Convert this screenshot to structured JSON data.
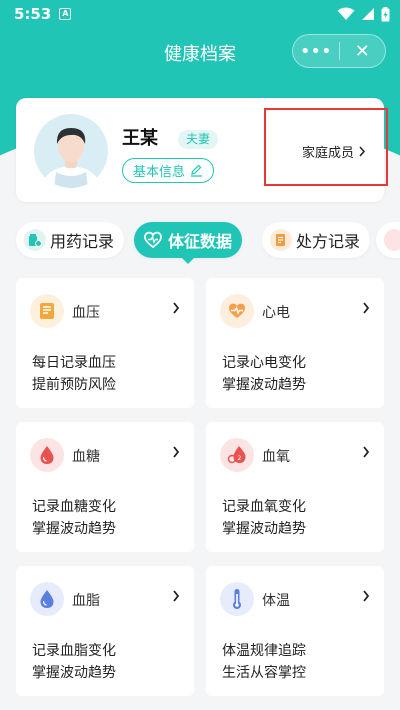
{
  "status_bar": {
    "time": "5:53",
    "app_badge": "A"
  },
  "header": {
    "title": "健康档案",
    "more_label": "•••",
    "close_label": "✕"
  },
  "profile": {
    "name": "王某",
    "relation": "夫妻",
    "basic_info_label": "基本信息",
    "family_members_label": "家庭成员"
  },
  "tabs": [
    {
      "label": "用药记录",
      "icon": "medicine-icon"
    },
    {
      "label": "体征数据",
      "icon": "heart-pulse-icon",
      "active": true
    },
    {
      "label": "处方记录",
      "icon": "prescription-icon"
    }
  ],
  "cards": [
    {
      "name": "血压",
      "line1": "每日记录血压",
      "line2": "提前预防风险",
      "icon": "blood-pressure-icon"
    },
    {
      "name": "心电",
      "line1": "记录心电变化",
      "line2": "掌握波动趋势",
      "icon": "ecg-icon"
    },
    {
      "name": "血糖",
      "line1": "记录血糖变化",
      "line2": "掌握波动趋势",
      "icon": "blood-sugar-icon"
    },
    {
      "name": "血氧",
      "line1": "记录血氧变化",
      "line2": "掌握波动趋势",
      "icon": "blood-oxygen-icon"
    },
    {
      "name": "血脂",
      "line1": "记录血脂变化",
      "line2": "掌握波动趋势",
      "icon": "blood-lipid-icon"
    },
    {
      "name": "体温",
      "line1": "体温规律追踪",
      "line2": "生活从容掌控",
      "icon": "thermometer-icon"
    }
  ],
  "colors": {
    "brand": "#20c5b5",
    "highlight_box": "#e53935"
  }
}
